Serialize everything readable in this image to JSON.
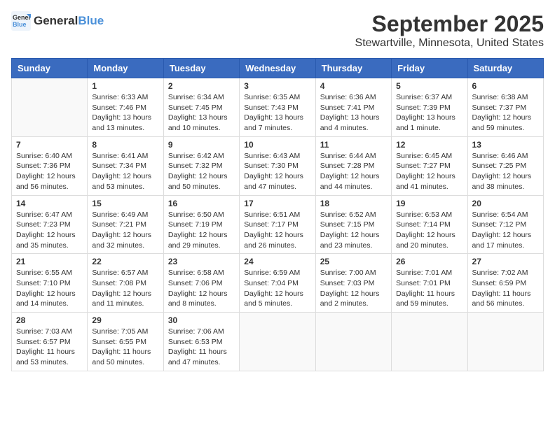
{
  "header": {
    "logo_general": "General",
    "logo_blue": "Blue",
    "month_title": "September 2025",
    "location": "Stewartville, Minnesota, United States"
  },
  "days_of_week": [
    "Sunday",
    "Monday",
    "Tuesday",
    "Wednesday",
    "Thursday",
    "Friday",
    "Saturday"
  ],
  "weeks": [
    [
      {
        "day": "",
        "info": ""
      },
      {
        "day": "1",
        "info": "Sunrise: 6:33 AM\nSunset: 7:46 PM\nDaylight: 13 hours\nand 13 minutes."
      },
      {
        "day": "2",
        "info": "Sunrise: 6:34 AM\nSunset: 7:45 PM\nDaylight: 13 hours\nand 10 minutes."
      },
      {
        "day": "3",
        "info": "Sunrise: 6:35 AM\nSunset: 7:43 PM\nDaylight: 13 hours\nand 7 minutes."
      },
      {
        "day": "4",
        "info": "Sunrise: 6:36 AM\nSunset: 7:41 PM\nDaylight: 13 hours\nand 4 minutes."
      },
      {
        "day": "5",
        "info": "Sunrise: 6:37 AM\nSunset: 7:39 PM\nDaylight: 13 hours\nand 1 minute."
      },
      {
        "day": "6",
        "info": "Sunrise: 6:38 AM\nSunset: 7:37 PM\nDaylight: 12 hours\nand 59 minutes."
      }
    ],
    [
      {
        "day": "7",
        "info": "Sunrise: 6:40 AM\nSunset: 7:36 PM\nDaylight: 12 hours\nand 56 minutes."
      },
      {
        "day": "8",
        "info": "Sunrise: 6:41 AM\nSunset: 7:34 PM\nDaylight: 12 hours\nand 53 minutes."
      },
      {
        "day": "9",
        "info": "Sunrise: 6:42 AM\nSunset: 7:32 PM\nDaylight: 12 hours\nand 50 minutes."
      },
      {
        "day": "10",
        "info": "Sunrise: 6:43 AM\nSunset: 7:30 PM\nDaylight: 12 hours\nand 47 minutes."
      },
      {
        "day": "11",
        "info": "Sunrise: 6:44 AM\nSunset: 7:28 PM\nDaylight: 12 hours\nand 44 minutes."
      },
      {
        "day": "12",
        "info": "Sunrise: 6:45 AM\nSunset: 7:27 PM\nDaylight: 12 hours\nand 41 minutes."
      },
      {
        "day": "13",
        "info": "Sunrise: 6:46 AM\nSunset: 7:25 PM\nDaylight: 12 hours\nand 38 minutes."
      }
    ],
    [
      {
        "day": "14",
        "info": "Sunrise: 6:47 AM\nSunset: 7:23 PM\nDaylight: 12 hours\nand 35 minutes."
      },
      {
        "day": "15",
        "info": "Sunrise: 6:49 AM\nSunset: 7:21 PM\nDaylight: 12 hours\nand 32 minutes."
      },
      {
        "day": "16",
        "info": "Sunrise: 6:50 AM\nSunset: 7:19 PM\nDaylight: 12 hours\nand 29 minutes."
      },
      {
        "day": "17",
        "info": "Sunrise: 6:51 AM\nSunset: 7:17 PM\nDaylight: 12 hours\nand 26 minutes."
      },
      {
        "day": "18",
        "info": "Sunrise: 6:52 AM\nSunset: 7:15 PM\nDaylight: 12 hours\nand 23 minutes."
      },
      {
        "day": "19",
        "info": "Sunrise: 6:53 AM\nSunset: 7:14 PM\nDaylight: 12 hours\nand 20 minutes."
      },
      {
        "day": "20",
        "info": "Sunrise: 6:54 AM\nSunset: 7:12 PM\nDaylight: 12 hours\nand 17 minutes."
      }
    ],
    [
      {
        "day": "21",
        "info": "Sunrise: 6:55 AM\nSunset: 7:10 PM\nDaylight: 12 hours\nand 14 minutes."
      },
      {
        "day": "22",
        "info": "Sunrise: 6:57 AM\nSunset: 7:08 PM\nDaylight: 12 hours\nand 11 minutes."
      },
      {
        "day": "23",
        "info": "Sunrise: 6:58 AM\nSunset: 7:06 PM\nDaylight: 12 hours\nand 8 minutes."
      },
      {
        "day": "24",
        "info": "Sunrise: 6:59 AM\nSunset: 7:04 PM\nDaylight: 12 hours\nand 5 minutes."
      },
      {
        "day": "25",
        "info": "Sunrise: 7:00 AM\nSunset: 7:03 PM\nDaylight: 12 hours\nand 2 minutes."
      },
      {
        "day": "26",
        "info": "Sunrise: 7:01 AM\nSunset: 7:01 PM\nDaylight: 11 hours\nand 59 minutes."
      },
      {
        "day": "27",
        "info": "Sunrise: 7:02 AM\nSunset: 6:59 PM\nDaylight: 11 hours\nand 56 minutes."
      }
    ],
    [
      {
        "day": "28",
        "info": "Sunrise: 7:03 AM\nSunset: 6:57 PM\nDaylight: 11 hours\nand 53 minutes."
      },
      {
        "day": "29",
        "info": "Sunrise: 7:05 AM\nSunset: 6:55 PM\nDaylight: 11 hours\nand 50 minutes."
      },
      {
        "day": "30",
        "info": "Sunrise: 7:06 AM\nSunset: 6:53 PM\nDaylight: 11 hours\nand 47 minutes."
      },
      {
        "day": "",
        "info": ""
      },
      {
        "day": "",
        "info": ""
      },
      {
        "day": "",
        "info": ""
      },
      {
        "day": "",
        "info": ""
      }
    ]
  ]
}
